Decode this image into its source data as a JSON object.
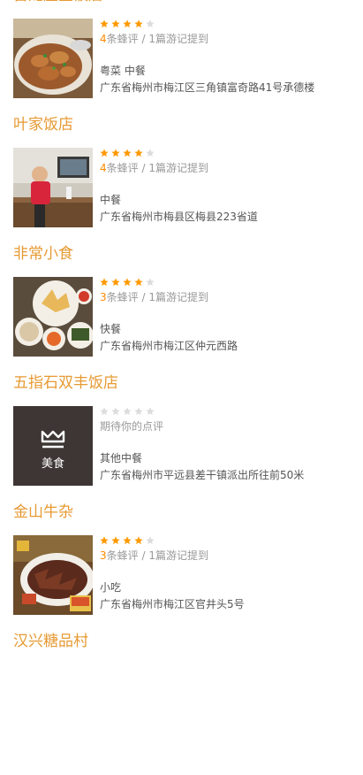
{
  "items": [
    {
      "name": "古龙屋堂饭店",
      "rating": 4,
      "count": "4",
      "count_suffix": "条蜂评",
      "notes": " / 1篇游记提到",
      "review_prompt": "",
      "category": "粤菜 中餐",
      "address": "广东省梅州市梅江区三角镇富奇路41号承德楼",
      "thumb": "food-stew-photo"
    },
    {
      "name": "叶家饭店",
      "rating": 4,
      "count": "4",
      "count_suffix": "条蜂评",
      "notes": " / 1篇游记提到",
      "review_prompt": "",
      "category": "中餐",
      "address": "广东省梅州市梅县区梅县223省道",
      "thumb": "restaurant-man-photo"
    },
    {
      "name": "非常小食",
      "rating": 4,
      "count": "3",
      "count_suffix": "条蜂评",
      "notes": " / 1篇游记提到",
      "review_prompt": "",
      "category": "快餐",
      "address": "广东省梅州市梅江区仲元西路",
      "thumb": "snack-plates-photo"
    },
    {
      "name": "五指石双丰饭店",
      "rating": 0,
      "count": "",
      "count_suffix": "",
      "notes": "",
      "review_prompt": "期待你的点评",
      "category": "其他中餐",
      "address": "广东省梅州市平远县差干镇派出所往前50米",
      "thumb": "placeholder",
      "thumb_label": "美食"
    },
    {
      "name": "金山牛杂",
      "rating": 4,
      "count": "3",
      "count_suffix": "条蜂评",
      "notes": " / 1篇游记提到",
      "review_prompt": "",
      "category": "小吃",
      "address": "广东省梅州市梅江区官井头5号",
      "thumb": "beef-offal-photo"
    },
    {
      "name": "汉兴糖品村",
      "rating": 0,
      "count": "",
      "count_suffix": "",
      "notes": "",
      "review_prompt": "",
      "category": "",
      "address": "",
      "thumb": "none"
    }
  ],
  "colors": {
    "title": "#e69a33",
    "star_on": "#ff9900",
    "star_off": "#dcdcdc",
    "count": "#ff8a00",
    "meta": "#999999",
    "text": "#555555"
  }
}
